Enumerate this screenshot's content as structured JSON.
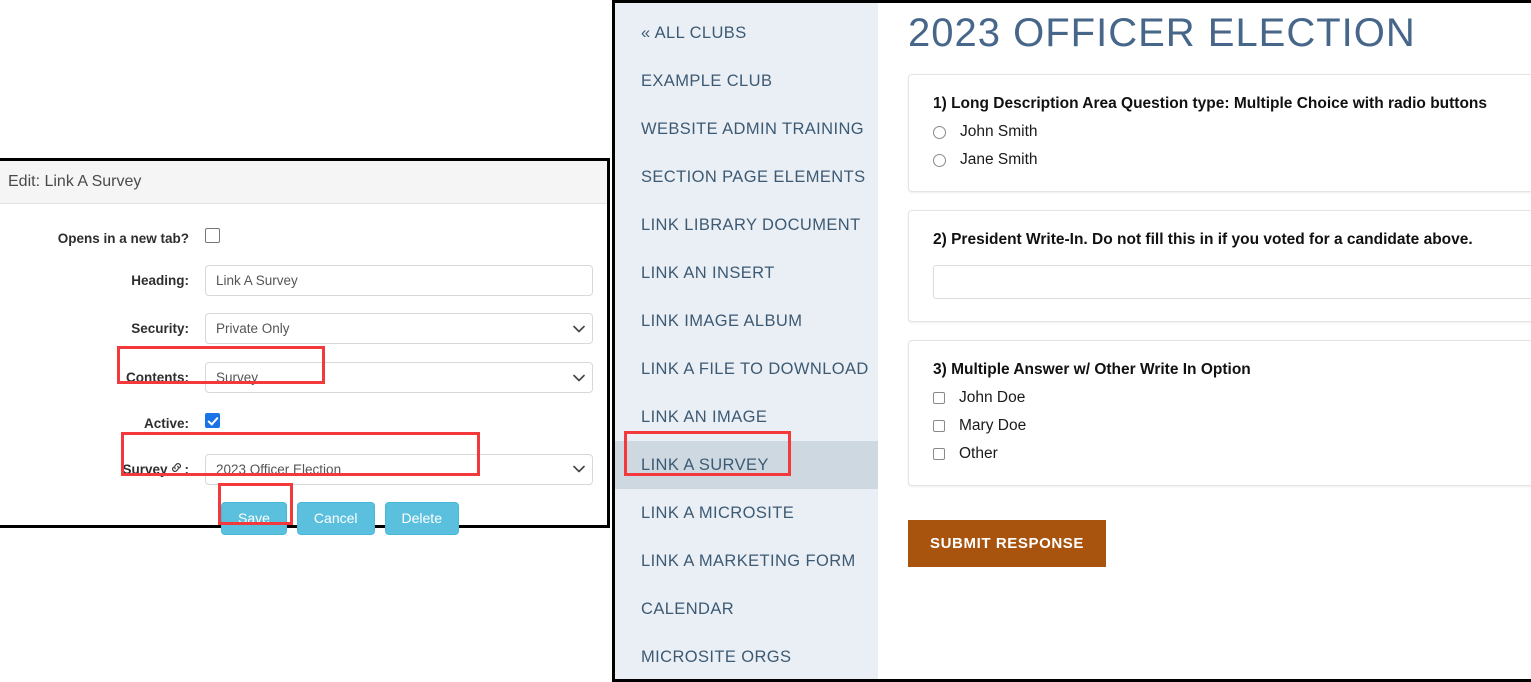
{
  "dialog": {
    "title": "Edit: Link A Survey",
    "fields": {
      "new_tab_label": "Opens in a new tab?",
      "heading_label": "Heading:",
      "heading_value": "Link A Survey",
      "security_label": "Security:",
      "security_value": "Private Only",
      "contents_label": "Contents:",
      "contents_value": "Survey",
      "active_label": "Active:",
      "survey_label": "Survey",
      "survey_label_suffix": ":",
      "survey_value": "2023 Officer Election"
    },
    "buttons": {
      "save": "Save",
      "cancel": "Cancel",
      "delete": "Delete"
    }
  },
  "sidebar": {
    "items": [
      {
        "label": "« ALL CLUBS",
        "active": false
      },
      {
        "label": "EXAMPLE CLUB",
        "active": false
      },
      {
        "label": "WEBSITE ADMIN TRAINING",
        "active": false
      },
      {
        "label": "SECTION PAGE ELEMENTS",
        "active": false
      },
      {
        "label": "LINK LIBRARY DOCUMENT",
        "active": false
      },
      {
        "label": "LINK AN INSERT",
        "active": false
      },
      {
        "label": "LINK IMAGE ALBUM",
        "active": false
      },
      {
        "label": "LINK A FILE TO DOWNLOAD",
        "active": false
      },
      {
        "label": "LINK AN IMAGE",
        "active": false
      },
      {
        "label": "LINK A SURVEY",
        "active": true
      },
      {
        "label": "LINK A MICROSITE",
        "active": false
      },
      {
        "label": "LINK A MARKETING FORM",
        "active": false
      },
      {
        "label": "CALENDAR",
        "active": false
      },
      {
        "label": "MICROSITE ORGS",
        "active": false
      }
    ]
  },
  "survey": {
    "title": "2023 OFFICER ELECTION",
    "questions": [
      {
        "text": "1) Long Description Area Question type: Multiple Choice with radio buttons",
        "type": "radio",
        "options": [
          "John Smith",
          "Jane Smith"
        ]
      },
      {
        "text": "2) President Write-In. Do not fill this in if you voted for a candidate above.",
        "type": "text",
        "value": "",
        "placeholder": ""
      },
      {
        "text": "3) Multiple Answer w/ Other Write In Option",
        "type": "checkbox",
        "options": [
          "John Doe",
          "Mary Doe",
          "Other"
        ]
      }
    ],
    "submit_label": "SUBMIT RESPONSE"
  },
  "colors": {
    "accent_button": "#5bc0de",
    "submit_button": "#a8540f",
    "highlight": "#f4393c",
    "sidebar_bg": "#eaeff5",
    "sidebar_active_bg": "#ced8e1",
    "nav_text": "#3d5a73",
    "title_text": "#46668a"
  }
}
